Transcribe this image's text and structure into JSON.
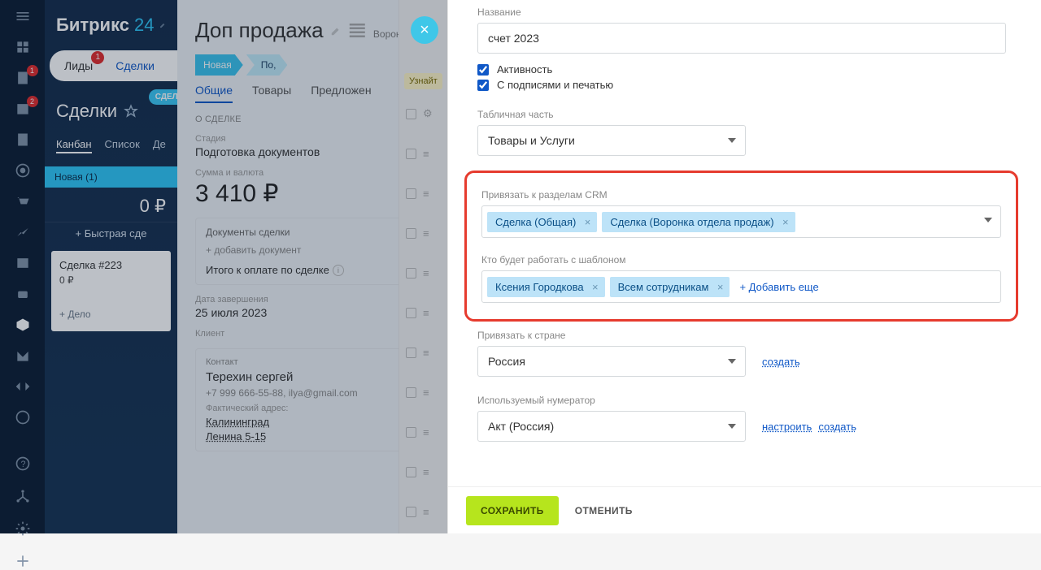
{
  "brand": {
    "name": "Битрикс",
    "suffix": "24"
  },
  "rail": {
    "badges": {
      "notes": "1",
      "cal": "2"
    }
  },
  "side": {
    "tabs": {
      "leads": "Лиды",
      "leads_badge": "1",
      "deals": "Сделки"
    },
    "pill": "СДЕЛКА",
    "title": "Сделки",
    "views": {
      "kanban": "Канбан",
      "list": "Список",
      "more": "Де"
    },
    "stage": "Новая (1)",
    "total": "0 ₽",
    "quick": "+  Быстрая сде",
    "card": {
      "title": "Сделка #223",
      "amount": "0 ₽",
      "plus": "+ Дело"
    }
  },
  "deal": {
    "title": "Доп продажа",
    "crumb": "Воронка с",
    "stages": {
      "s1": "Новая",
      "s2": "По,"
    },
    "tabs": {
      "general": "Общие",
      "goods": "Товары",
      "offers": "Предложен"
    },
    "section_about": "О СДЕЛКЕ",
    "stage_lbl": "Стадия",
    "stage_val": "Подготовка документов",
    "sum_lbl": "Сумма и валюта",
    "sum_val": "3 410 ₽",
    "docs_h": "Документы сделки",
    "docs_add": "+ добавить документ",
    "docs_total": "Итого к оплате по сделке",
    "end_lbl": "Дата завершения",
    "end_val": "25 июля 2023",
    "client_lbl": "Клиент",
    "contact_lbl": "Контакт",
    "contact_name": "Терехин сергей",
    "contact_phone": "+7 999 666-55-88, ilya@gmail.com",
    "contact_fact": "Фактический адрес:",
    "contact_city": "Калининград",
    "contact_street": "Ленина 5-15"
  },
  "strip": {
    "learn": "Узнайт"
  },
  "modal": {
    "name_lbl": "Название",
    "name_val": "счет 2023",
    "chk_active": "Активность",
    "chk_stamp": "С подписями и печатью",
    "table_lbl": "Табличная часть",
    "table_val": "Товары и Услуги",
    "crm_lbl": "Привязать к разделам CRM",
    "crm_tags": [
      "Сделка (Общая)",
      "Сделка (Воронка отдела продаж)"
    ],
    "users_lbl": "Кто будет работать с шаблоном",
    "users_tags": [
      "Ксения Городкова",
      "Всем сотрудникам"
    ],
    "users_add": "+ Добавить еще",
    "country_lbl": "Привязать к стране",
    "country_val": "Россия",
    "country_create": "создать",
    "numer_lbl": "Используемый нумератор",
    "numer_val": "Акт (Россия)",
    "numer_setup": "настроить",
    "numer_create": "создать",
    "save": "СОХРАНИТЬ",
    "cancel": "ОТМЕНИТЬ"
  }
}
